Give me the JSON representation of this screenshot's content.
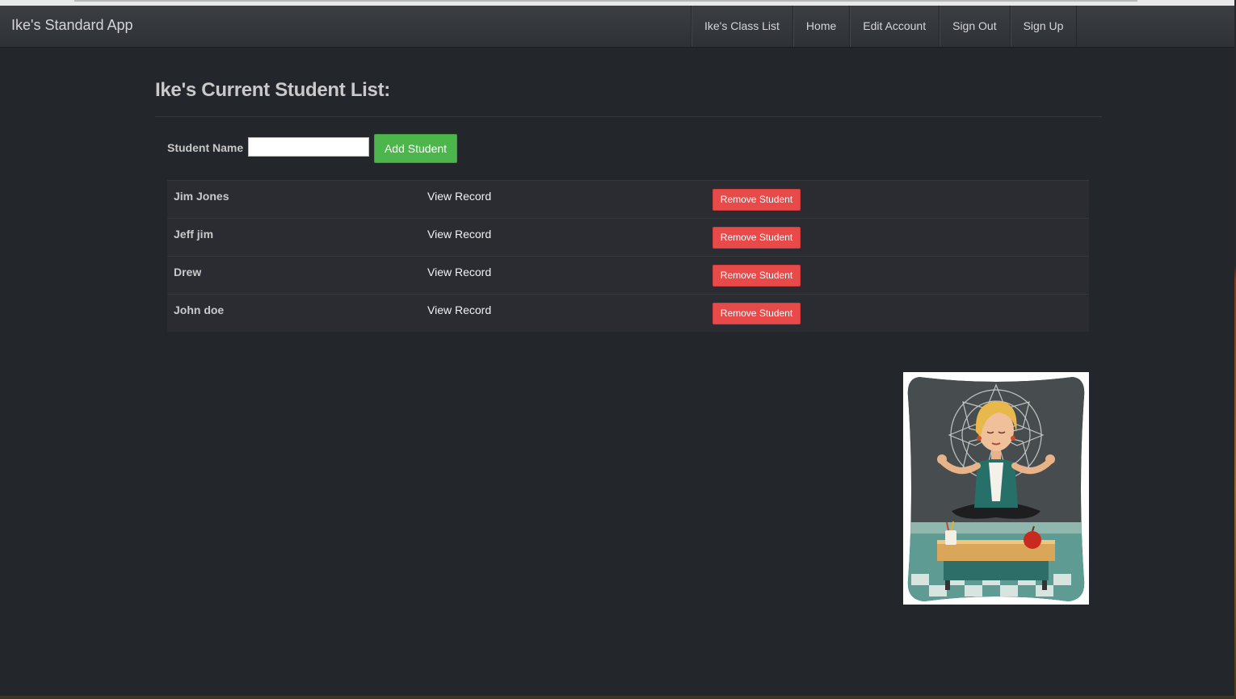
{
  "app": {
    "brand": "Ike's Standard App"
  },
  "nav": {
    "items": [
      "Ike's Class List",
      "Home",
      "Edit Account",
      "Sign Out",
      "Sign Up"
    ]
  },
  "page": {
    "title": "Ike's Current Student List:"
  },
  "form": {
    "label": "Student Name",
    "value": "",
    "button": "Add Student"
  },
  "students": [
    {
      "name": "Jim Jones",
      "view": "View Record",
      "remove": "Remove Student"
    },
    {
      "name": "Jeff jim",
      "view": "View Record",
      "remove": "Remove Student"
    },
    {
      "name": "Drew",
      "view": "View Record",
      "remove": "Remove Student"
    },
    {
      "name": "John doe",
      "view": "View Record",
      "remove": "Remove Student"
    }
  ],
  "colors": {
    "background": "#23262b",
    "navbar": "#33363b",
    "add_button": "#4cb54c",
    "remove_button": "#e84a4a"
  },
  "illustration": {
    "icon": "meditating-teacher-illustration"
  }
}
